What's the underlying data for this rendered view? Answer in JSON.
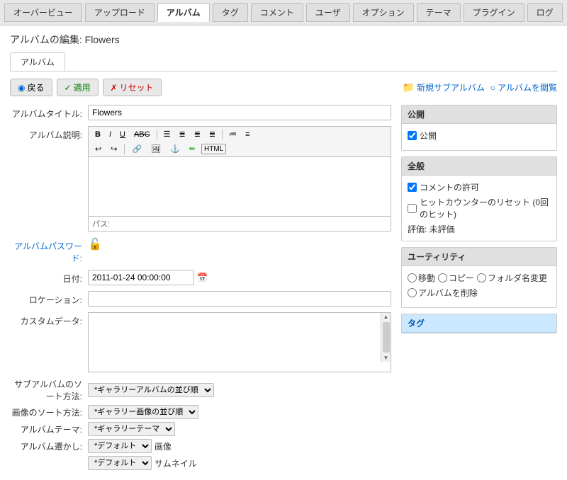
{
  "nav": {
    "tabs": [
      {
        "label": "オーバービュー",
        "active": false
      },
      {
        "label": "アップロード",
        "active": false
      },
      {
        "label": "アルバム",
        "active": true
      },
      {
        "label": "タグ",
        "active": false
      },
      {
        "label": "コメント",
        "active": false
      },
      {
        "label": "ユーザ",
        "active": false
      },
      {
        "label": "オプション",
        "active": false
      },
      {
        "label": "テーマ",
        "active": false
      },
      {
        "label": "プラグイン",
        "active": false
      },
      {
        "label": "ログ",
        "active": false
      }
    ]
  },
  "page": {
    "title": "アルバムの編集: Flowers",
    "sub_tab": "アルバム"
  },
  "actions": {
    "back": "戻る",
    "apply": "適用",
    "reset": "リセット",
    "new_sub_album": "新規サブアルバム",
    "browse_album": "アルバムを閲覧"
  },
  "form": {
    "album_title_label": "アルバムタイトル:",
    "album_title_value": "Flowers",
    "album_desc_label": "アルバム説明:",
    "path_label": "パス:",
    "password_label": "アルバムパスワード:",
    "date_label": "日付:",
    "date_value": "2011-01-24 00:00:00",
    "location_label": "ロケーション:",
    "custom_data_label": "カスタムデータ:",
    "sub_sort_label": "サブアルバムのソート方法:",
    "sub_sort_value": "*ギャラリーアルバムの並び順",
    "image_sort_label": "画像のソート方法:",
    "image_sort_value": "*ギャラリー画像の並び順",
    "album_theme_label": "アルバムテーマ:",
    "album_theme_value": "*ギャラリーテーマ",
    "album_display_label": "アルバム遷かし:",
    "album_display_value": "*デフォルト",
    "album_display_image": "画像",
    "thumbnail_value": "*デフォルト",
    "thumbnail_label": "サムネイル"
  },
  "toolbar": {
    "bold": "B",
    "italic": "I",
    "underline": "U",
    "strike": "ABC",
    "align_left": "≡",
    "align_center": "≡",
    "align_right": "≡",
    "align_justify": "≡",
    "list_ol": "≔",
    "list_ul": "≕"
  },
  "right": {
    "publish_header": "公開",
    "publish_check": "公開",
    "publish_checked": true,
    "general_header": "全般",
    "comment_check": "コメントの許可",
    "comment_checked": true,
    "hit_reset_check": "ヒットカウンターのリセット (0回のヒット)",
    "hit_reset_checked": false,
    "rating_label": "評価: 未評価",
    "utility_header": "ユーティリティ",
    "move_label": "移動",
    "copy_label": "コピー",
    "rename_label": "フォルダ名変更",
    "delete_label": "アルバムを削除",
    "tags_header": "タグ"
  }
}
